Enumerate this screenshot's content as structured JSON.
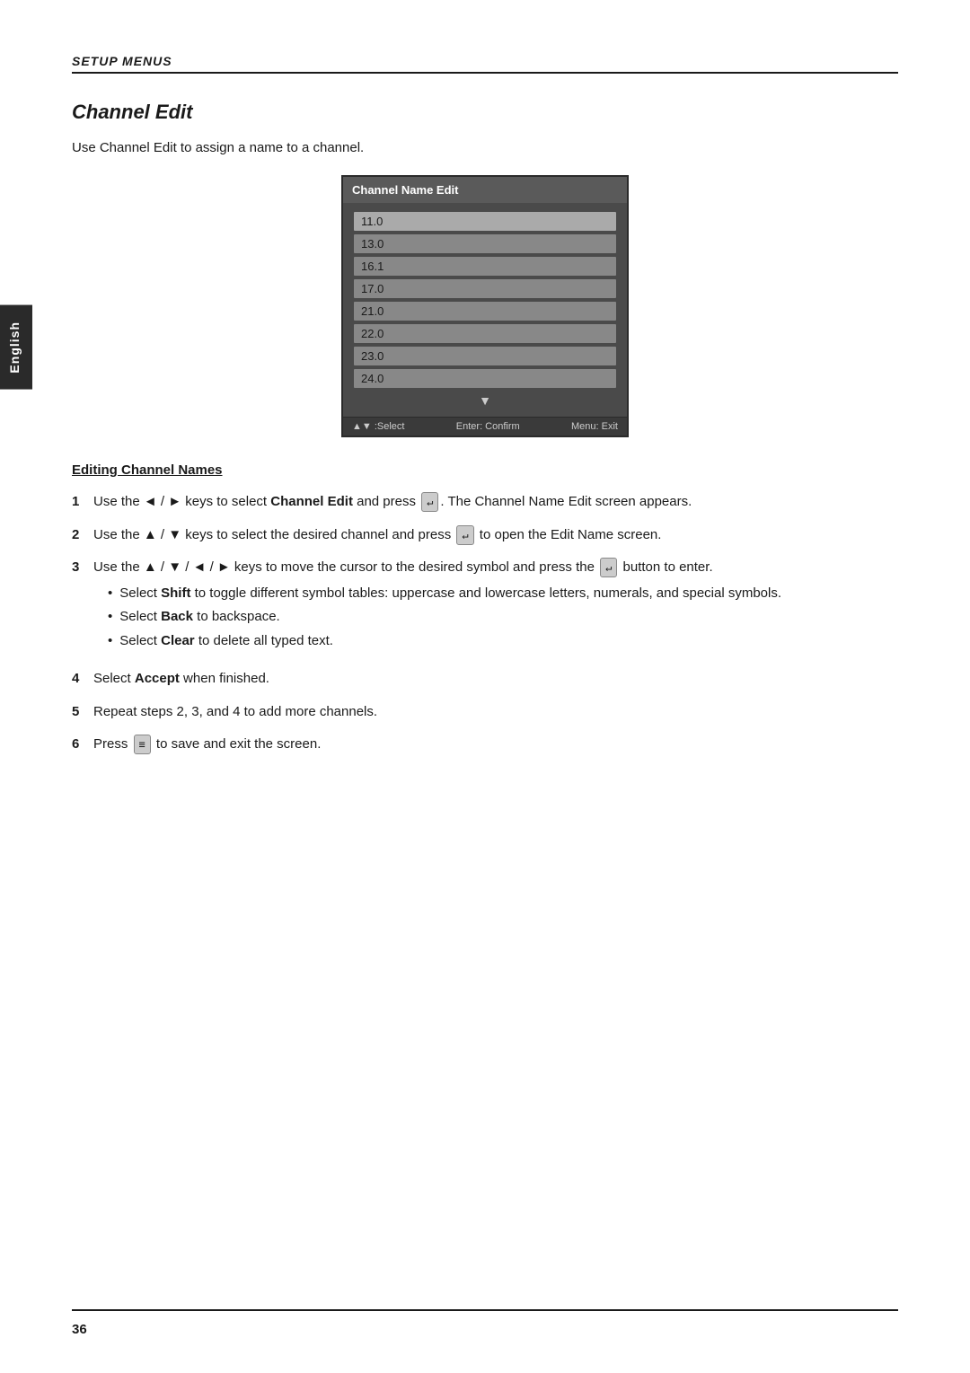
{
  "section": {
    "label": "SETUP MENUS",
    "title": "Channel Edit",
    "intro": "Use Channel Edit to assign a name to a channel."
  },
  "screen": {
    "header": "Channel Name Edit",
    "channels": [
      "11.0",
      "13.0",
      "16.1",
      "17.0",
      "21.0",
      "22.0",
      "23.0",
      "24.0"
    ],
    "footer": {
      "select": "▲▼  :Select",
      "confirm": "Enter: Confirm",
      "exit": "Menu: Exit"
    }
  },
  "subheading": "Editing Channel Names",
  "steps": [
    {
      "number": "1",
      "text_before": "Use the ◄ / ► keys to select ",
      "bold1": "Channel Edit",
      "text_mid": " and press ",
      "key1": "↵",
      "text_after": ". The Channel Name Edit screen appears."
    },
    {
      "number": "2",
      "text_before": "Use the ▲ / ▼ keys to select the desired channel and press ",
      "key1": "↵",
      "text_after": " to open the Edit Name screen."
    },
    {
      "number": "3",
      "text_before": "Use the ▲ / ▼ / ◄ / ► keys to move the cursor to the desired symbol and press the ",
      "key1": "↵",
      "text_after": " button to enter.",
      "bullets": [
        {
          "text_before": "Select ",
          "bold1": "Shift",
          "text_after": " to toggle different symbol tables: uppercase and lowercase letters, numerals, and special symbols."
        },
        {
          "text_before": "Select ",
          "bold1": "Back",
          "text_after": " to backspace."
        },
        {
          "text_before": "Select ",
          "bold1": "Clear",
          "text_after": " to delete all typed text."
        }
      ]
    },
    {
      "number": "4",
      "text_before": "Select ",
      "bold1": "Accept",
      "text_after": " when finished."
    },
    {
      "number": "5",
      "text_only": "Repeat steps 2, 3, and 4 to add more channels."
    },
    {
      "number": "6",
      "text_before": "Press ",
      "key1": "≡",
      "text_after": " to save and exit the screen."
    }
  ],
  "sidebar": {
    "label": "English"
  },
  "page_number": "36"
}
